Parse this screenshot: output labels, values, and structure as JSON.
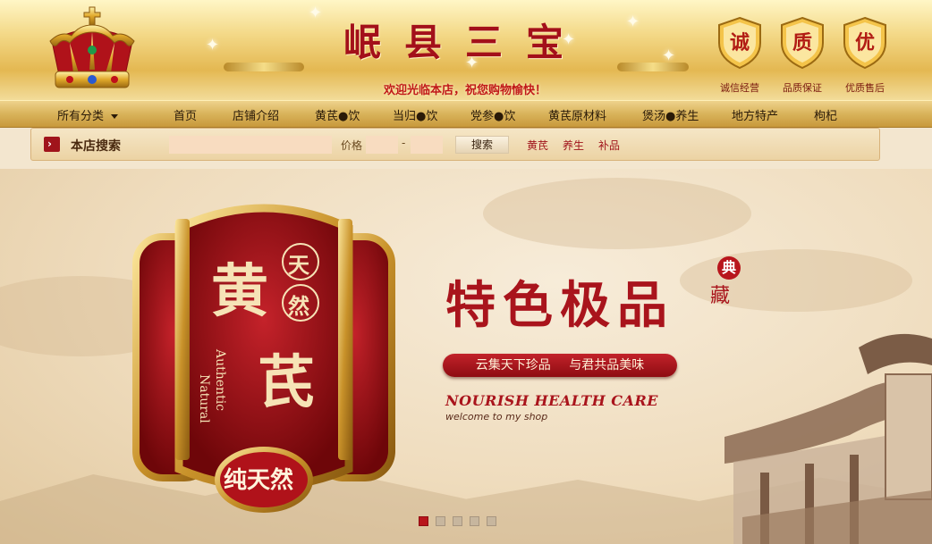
{
  "header": {
    "title": "岷县三宝",
    "welcome": "欢迎光临本店，祝您购物愉快！",
    "badges": [
      {
        "glyph": "诚",
        "caption": "诚信经营"
      },
      {
        "glyph": "质",
        "caption": "品质保证"
      },
      {
        "glyph": "优",
        "caption": "优质售后"
      }
    ],
    "icons": [
      "crown-icon",
      "sparkle-icon",
      "shield-icon"
    ]
  },
  "nav": {
    "items": [
      "所有分类",
      "首页",
      "店铺介绍",
      "黄芪●饮",
      "当归●饮",
      "党参●饮",
      "黄芪原材料",
      "煲汤●养生",
      "地方特产",
      "枸杞"
    ]
  },
  "search": {
    "label": "本店搜索",
    "input_value": "",
    "price_label": "价格",
    "price_min": "",
    "price_max": "",
    "price_separator": "-",
    "button": "搜索",
    "hot_tags": [
      "黄芪",
      "养生",
      "补品"
    ]
  },
  "banner": {
    "plaque": {
      "big_top": "黄",
      "big_bottom": "芪",
      "circle_1": "天",
      "circle_2": "然",
      "en_1": "Natural",
      "en_2": "Authentic",
      "seal": "纯天然"
    },
    "slogan": "特色极品",
    "seal_top": "典",
    "seal_bottom": "藏",
    "ribbon": "云集天下珍品 与君共品美味",
    "en_title": "NOURISH HEALTH CARE",
    "en_sub": "welcome to my shop",
    "slides_count": 5,
    "active_slide": 1
  },
  "colors": {
    "brand_red": "#a9141c",
    "gold": "#e4b852",
    "background": "#f3e6cf"
  }
}
